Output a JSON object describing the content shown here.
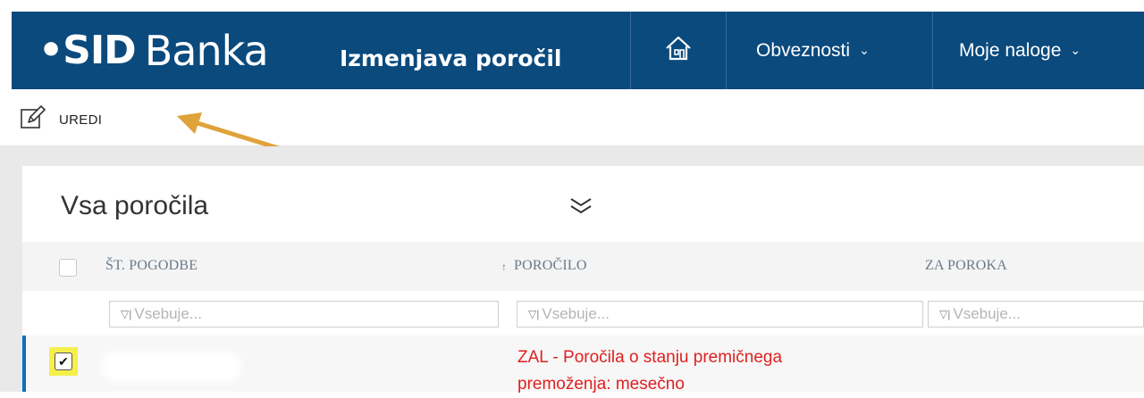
{
  "header": {
    "logo_mark": "•SID",
    "logo_text": "Banka",
    "app_title": "Izmenjava poročil",
    "nav": [
      {
        "label": "Obveznosti"
      },
      {
        "label": "Moje naloge"
      }
    ]
  },
  "toolbar": {
    "edit_label": "UREDI"
  },
  "panel": {
    "title": "Vsa poročila",
    "columns": [
      {
        "label": "ŠT. POGODBE"
      },
      {
        "label": "POROČILO",
        "sort": "↑"
      },
      {
        "label": "ZA POROKA"
      }
    ],
    "filter_placeholder": "Vsebuje...",
    "rows": [
      {
        "checked": true,
        "report_line1": "ZAL - Poročila o stanju premičnega",
        "report_line2": "premoženja: mesečno"
      }
    ]
  },
  "colors": {
    "brand": "#0b4a7d",
    "highlight": "#f5ef4b",
    "annotation_arrow": "#e0a23a",
    "report_text": "#e02020"
  }
}
